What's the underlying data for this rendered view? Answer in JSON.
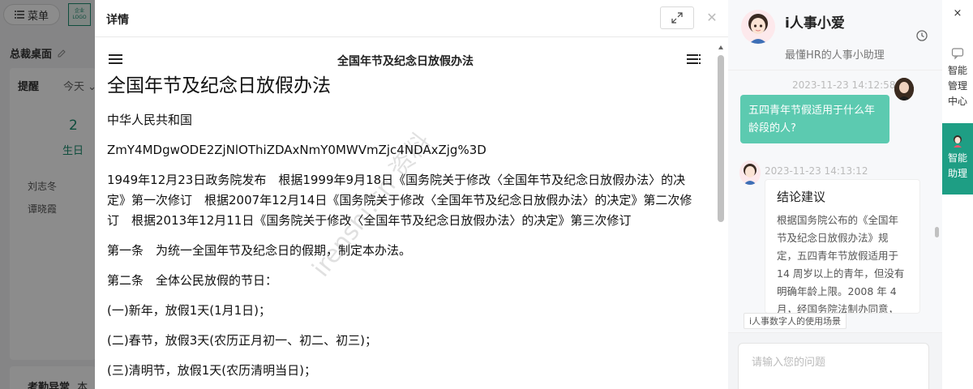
{
  "background": {
    "menu_label": "菜单",
    "logo_line1": "企业",
    "logo_line2": "LOGO",
    "dashboard_title": "总裁桌面",
    "remind_label": "提醒",
    "today_label": "今天",
    "stat_value": "2",
    "stat_label": "生日",
    "people": [
      "刘志冬",
      "谭晓霞"
    ],
    "attendance_label": "考勤异常",
    "attendance_suffix": "本"
  },
  "modal": {
    "title": "详情",
    "doc_heading": "全国年节及纪念日放假办法",
    "doc_title": "全国年节及纪念日放假办法",
    "paragraphs": [
      "中华人民共和国",
      "ZmY4MDgwODE2ZjNlOThiZDAxNmY0MWVmZjc4NDAxZjg%3D",
      "1949年12月23日政务院发布　根据1999年9月18日《国务院关于修改〈全国年节及纪念日放假办法〉的决定》第一次修订　根据2007年12月14日《国务院关于修改〈全国年节及纪念日放假办法〉的决定》第二次修订　根据2013年12月11日《国务院关于修改〈全国年节及纪念日放假办法〉的决定》第三次修订",
      "第一条　为统一全国年节及纪念日的假期，制定本办法。",
      "第二条　全体公民放假的节日：",
      "(一)新年，放假1天(1月1日)；",
      "(二)春节，放假3天(农历正月初一、初二、初三)；",
      "(三)清明节，放假1天(农历清明当日)；"
    ],
    "watermark": "irenshi.cn 资料"
  },
  "assistant": {
    "name": "i人事小爱",
    "subtitle": "最懂HR的人事小助理",
    "user_time": "2023-11-23 14:12:58",
    "user_message": "五四青年节假适用于什么年龄段的人?",
    "bot_time": "2023-11-23 14:13:12",
    "answer_title": "结论建议",
    "answer_text": "根据国务院公布的《全国年节及纪念日放假办法》规定，五四青年节放假适用于 14 周岁以上的青年，但没有明确年龄上限。2008 年 4 月，经国务院法制办同意，",
    "scene_tag": "i人事数字人的使用场景",
    "input_placeholder": "请输入您的问题"
  },
  "rail": {
    "close": "×",
    "item1_label": "智能管理中心",
    "item2_label": "智能助理"
  },
  "colors": {
    "accent": "#1e9e84",
    "bubble": "#5ccab0"
  }
}
